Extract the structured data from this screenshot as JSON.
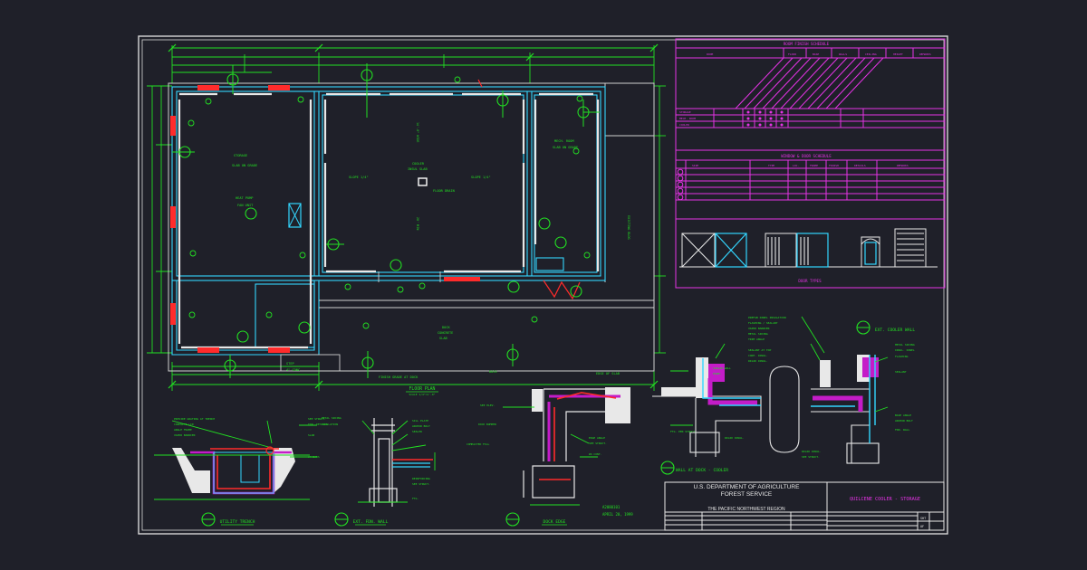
{
  "floor_plan": {
    "title": "FLOOR PLAN",
    "rooms": {
      "left": "STORAGE",
      "center": "COOLER",
      "right": "MECH. ROOM",
      "bottom": "DOCK"
    }
  },
  "schedules": {
    "room_finish": {
      "title": "ROOM FINISH SCHEDULE",
      "headers": [
        "ROOM",
        "FLOOR",
        "BASE",
        "WALLS",
        "CEILING",
        "HEIGHT",
        "REMARKS"
      ]
    },
    "window_door": {
      "title": "WINDOW & DOOR SCHEDULE",
      "headers": [
        "NO.",
        "SIZE",
        "TYPE",
        "LOC.",
        "FRAME",
        "FINISH",
        "DETAILS",
        "REMARKS"
      ]
    },
    "door_types_title": "DOOR TYPES"
  },
  "details": {
    "utility_trench": "UTILITY TRENCH",
    "ext_fdn_wall": "EXT. FDN. WALL",
    "dock_edge": "DOCK EDGE",
    "wall_at_dock": "WALL AT DOCK - COOLER",
    "ext_cooler_wall": "EXT. COOLER WALL"
  },
  "drawing_number": "A2080101",
  "drawing_date": "APRIL 20, 1999",
  "title_block": {
    "agency_line1": "U.S. DEPARTMENT OF AGRICULTURE",
    "agency_line2": "FOREST SERVICE",
    "region": "THE PACIFIC NORTHWEST REGION",
    "project": "QUILCENE COOLER - STORAGE",
    "sheet_label": "SHT",
    "sheet_of": "OF"
  },
  "colors": {
    "background": "#1f2029",
    "border": "#d8d8d8",
    "dimension": "#22e022",
    "walls": "#33d6ff",
    "schedule": "#e533e5",
    "insulation": "#c41cc8",
    "accent_red": "#ff2b2b",
    "text_white": "#e8e8e8"
  }
}
